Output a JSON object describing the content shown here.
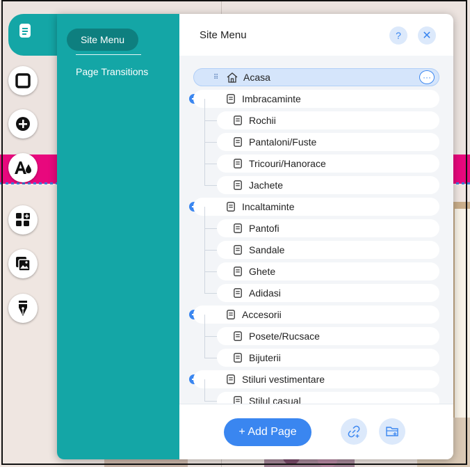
{
  "side_menu": {
    "active_item": "Site Menu",
    "secondary_item": "Page Transitions"
  },
  "header": {
    "title": "Site Menu",
    "help_label": "?",
    "close_label": "✕"
  },
  "home_page": {
    "label": "Acasa",
    "more_label": "···"
  },
  "pages": [
    {
      "label": "Imbracaminte",
      "level": 0,
      "collapsible": true
    },
    {
      "label": "Rochii",
      "level": 1
    },
    {
      "label": "Pantaloni/Fuste",
      "level": 1
    },
    {
      "label": "Tricouri/Hanorace",
      "level": 1
    },
    {
      "label": "Jachete",
      "level": 1
    },
    {
      "label": "Incaltaminte",
      "level": 0,
      "collapsible": true
    },
    {
      "label": "Pantofi",
      "level": 1
    },
    {
      "label": "Sandale",
      "level": 1
    },
    {
      "label": "Ghete",
      "level": 1
    },
    {
      "label": "Adidasi",
      "level": 1
    },
    {
      "label": "Accesorii",
      "level": 0,
      "collapsible": true
    },
    {
      "label": "Posete/Rucsace",
      "level": 1
    },
    {
      "label": "Bijuterii",
      "level": 1
    },
    {
      "label": "Stiluri vestimentare",
      "level": 0,
      "collapsible": true
    },
    {
      "label": "Stilul casual",
      "level": 1
    }
  ],
  "footer": {
    "add_page_label": "+ Add Page"
  },
  "colors": {
    "teal": "#14a6a6",
    "teal_dark": "#0e7f7f",
    "accent_blue": "#3a86f0",
    "home_highlight": "#d5e5fb"
  }
}
